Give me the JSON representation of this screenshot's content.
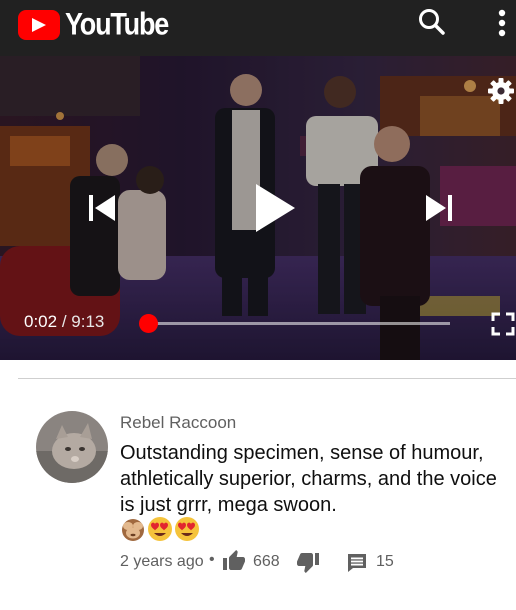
{
  "appbar": {
    "logo_text": "YouTube",
    "icons": {
      "logo": "youtube-play-logo",
      "search": "search-icon",
      "more": "more-vert-icon"
    }
  },
  "player": {
    "current_time": "0:02",
    "separator": "/",
    "duration": "9:13",
    "progress_fraction": 0.004,
    "state": "paused",
    "icons": {
      "settings": "gear-icon",
      "previous": "skip-previous-icon",
      "play": "play-icon",
      "next": "skip-next-icon",
      "fullscreen": "fullscreen-icon"
    }
  },
  "comment": {
    "author": "Rebel Raccoon",
    "text": "Outstanding specimen, sense of humour, athletically superior, charms, and the voice is just grrr, mega swoon.",
    "emojis": [
      "🙈",
      "😍",
      "😍"
    ],
    "time_ago": "2 years ago",
    "dot": "•",
    "like_count": "668",
    "reply_count": "15",
    "icons": {
      "like": "thumb-up-icon",
      "dislike": "thumb-down-icon",
      "reply": "reply-comment-icon"
    }
  },
  "colors": {
    "appbar_bg": "#212121",
    "brand_red": "#ff0000",
    "text_primary": "#0f0f0f",
    "text_secondary": "#606060"
  }
}
